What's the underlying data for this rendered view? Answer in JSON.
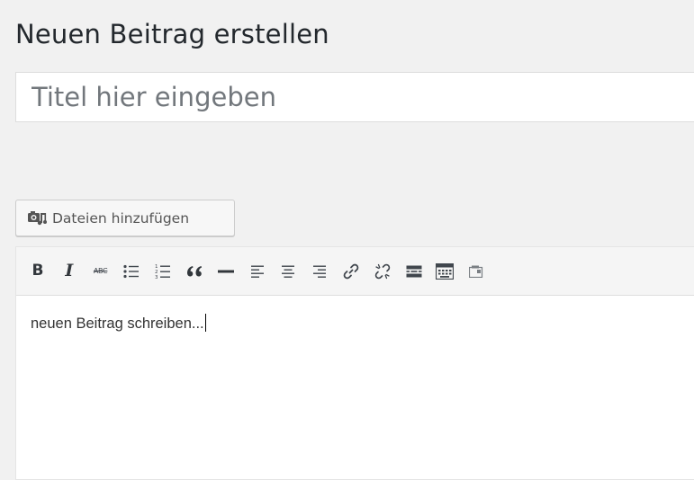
{
  "page": {
    "title": "Neuen Beitrag erstellen"
  },
  "title_field": {
    "placeholder": "Titel hier eingeben",
    "value": ""
  },
  "media_button": {
    "label": "Dateien hinzufügen",
    "icon": "add-media-icon"
  },
  "toolbar": {
    "buttons": [
      {
        "name": "bold",
        "icon": "bold-icon",
        "text": "B"
      },
      {
        "name": "italic",
        "icon": "italic-icon",
        "text": "I"
      },
      {
        "name": "strikethrough",
        "icon": "strikethrough-icon",
        "text": "ABC"
      },
      {
        "name": "bulleted-list",
        "icon": "bulleted-list-icon"
      },
      {
        "name": "numbered-list",
        "icon": "numbered-list-icon"
      },
      {
        "name": "blockquote",
        "icon": "blockquote-icon",
        "text": "“"
      },
      {
        "name": "horizontal-line",
        "icon": "horizontal-line-icon"
      },
      {
        "name": "align-left",
        "icon": "align-left-icon"
      },
      {
        "name": "align-center",
        "icon": "align-center-icon"
      },
      {
        "name": "align-right",
        "icon": "align-right-icon"
      },
      {
        "name": "insert-link",
        "icon": "link-icon"
      },
      {
        "name": "remove-link",
        "icon": "unlink-icon"
      },
      {
        "name": "read-more",
        "icon": "read-more-icon"
      },
      {
        "name": "toolbar-toggle",
        "icon": "toolbar-toggle-icon"
      },
      {
        "name": "more",
        "icon": "more-icon"
      }
    ]
  },
  "editor": {
    "content": "neuen Beitrag schreiben..."
  },
  "colors": {
    "background": "#f1f1f1",
    "text": "#23282d",
    "placeholder": "#72777c",
    "toolbar_bg": "#f5f5f5"
  }
}
